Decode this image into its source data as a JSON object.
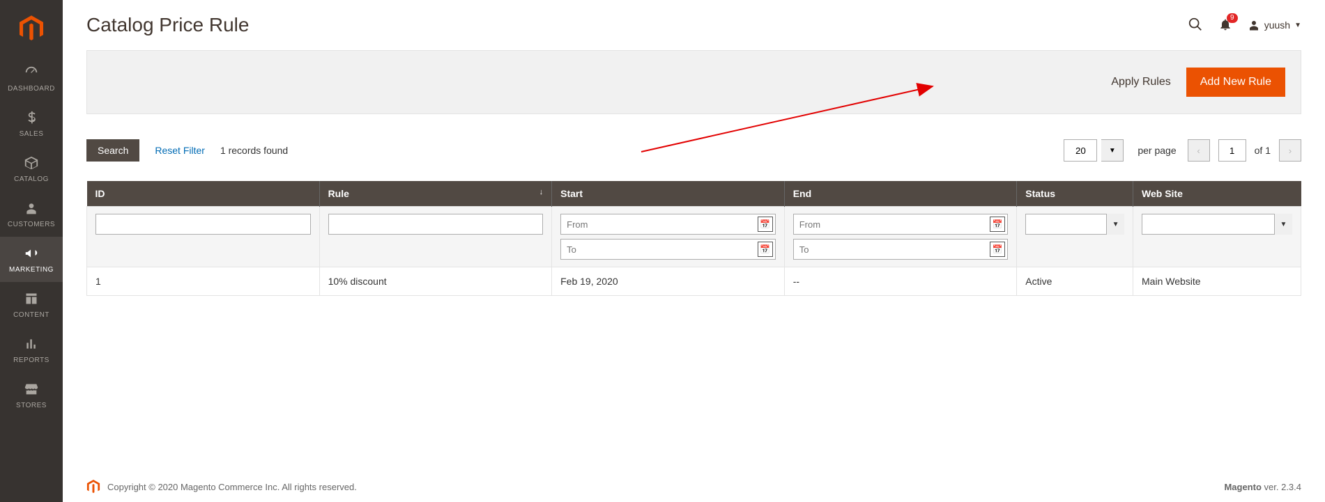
{
  "colors": {
    "accent": "#eb5202",
    "header_dark": "#514943",
    "link": "#006bb4",
    "badge": "#e22626"
  },
  "sidebar": {
    "items": [
      {
        "label": "DASHBOARD",
        "icon": "dashboard-icon"
      },
      {
        "label": "SALES",
        "icon": "dollar-icon"
      },
      {
        "label": "CATALOG",
        "icon": "cube-icon"
      },
      {
        "label": "CUSTOMERS",
        "icon": "person-icon"
      },
      {
        "label": "MARKETING",
        "icon": "megaphone-icon"
      },
      {
        "label": "CONTENT",
        "icon": "layout-icon"
      },
      {
        "label": "REPORTS",
        "icon": "bar-chart-icon"
      },
      {
        "label": "STORES",
        "icon": "store-icon"
      }
    ],
    "active_index": 4
  },
  "header": {
    "title": "Catalog Price Rule",
    "notifications_count": "9",
    "user_name": "yuush"
  },
  "actions": {
    "apply_rules": "Apply Rules",
    "add_new_rule": "Add New Rule"
  },
  "toolbar": {
    "search_label": "Search",
    "reset_filter_label": "Reset Filter",
    "records_found": "1 records found",
    "per_page_value": "20",
    "per_page_label": "per page",
    "page_value": "1",
    "of_label": "of 1"
  },
  "table": {
    "columns": [
      "ID",
      "Rule",
      "Start",
      "End",
      "Status",
      "Web Site"
    ],
    "sort_column_index": 1,
    "filters": {
      "from_placeholder": "From",
      "to_placeholder": "To"
    },
    "rows": [
      {
        "id": "1",
        "rule": "10% discount",
        "start": "Feb 19, 2020",
        "end": "--",
        "status": "Active",
        "website": "Main Website"
      }
    ]
  },
  "footer": {
    "copyright": "Copyright © 2020 Magento Commerce Inc. All rights reserved.",
    "version_brand": "Magento",
    "version_text": " ver. 2.3.4"
  }
}
